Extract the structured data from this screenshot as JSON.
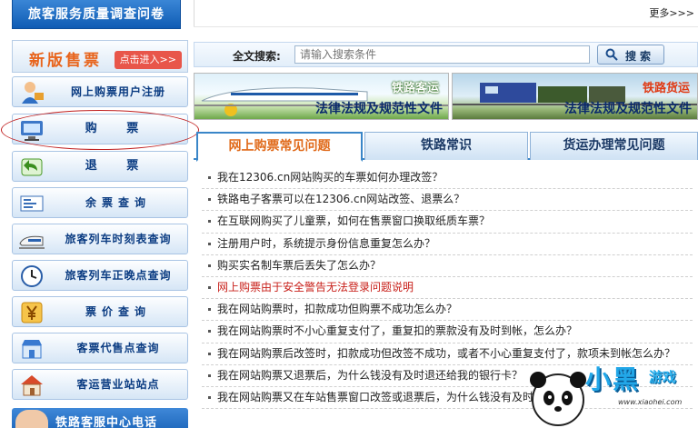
{
  "top": {
    "survey_banner": "旅客服务质量调查问卷",
    "more_link": "更多>>>"
  },
  "sidebar": {
    "new_ticket_title": "新版售票",
    "enter_button": "点击进入>>",
    "items": [
      {
        "label": "网上购票用户注册",
        "icon": "user-icon"
      },
      {
        "label": "购 票",
        "icon": "computer-icon"
      },
      {
        "label": "退 票",
        "icon": "return-arrow-icon"
      },
      {
        "label": "余票查询",
        "icon": "ticket-search-icon"
      },
      {
        "label": "旅客列车时刻表查询",
        "icon": "train-icon"
      },
      {
        "label": "旅客列车正晚点查询",
        "icon": "clock-icon"
      },
      {
        "label": "票价查询",
        "icon": "yen-icon"
      },
      {
        "label": "客票代售点查询",
        "icon": "shop-icon"
      },
      {
        "label": "客运营业站站点",
        "icon": "house-icon"
      }
    ],
    "hotline": "铁路客服中心电话"
  },
  "search": {
    "label": "全文搜索:",
    "placeholder": "请输入搜索条件",
    "button_label": "搜索"
  },
  "banners": {
    "passenger": {
      "tag": "铁路客运",
      "caption": "法律法规及规范性文件"
    },
    "freight": {
      "tag": "铁路货运",
      "caption": "法律法规及规范性文件"
    }
  },
  "tabs": [
    {
      "label": "网上购票常见问题",
      "active": true
    },
    {
      "label": "铁路常识",
      "active": false
    },
    {
      "label": "货运办理常见问题",
      "active": false
    }
  ],
  "faq": [
    {
      "text": "我在12306.cn网站购买的车票如何办理改签？",
      "alert": false
    },
    {
      "text": "铁路电子客票可以在12306.cn网站改签、退票么？",
      "alert": false
    },
    {
      "text": "在互联网购买了儿童票，如何在售票窗口换取纸质车票？",
      "alert": false
    },
    {
      "text": "注册用户时，系统提示身份信息重复怎么办？",
      "alert": false
    },
    {
      "text": "购买实名制车票后丢失了怎么办？",
      "alert": false
    },
    {
      "text": "网上购票由于安全警告无法登录问题说明",
      "alert": true
    },
    {
      "text": "我在网站购票时，扣款成功但购票不成功怎么办？",
      "alert": false
    },
    {
      "text": "我在网站购票时不小心重复支付了，重复扣的票款没有及时到帐，怎么办？",
      "alert": false
    },
    {
      "text": "我在网站购票后改签时，扣款成功但改签不成功，或者不小心重复支付了，款项未到帐怎么办？",
      "alert": false
    },
    {
      "text": "我在网站购票又退票后，为什么钱没有及时退还给我的银行卡？",
      "alert": false
    },
    {
      "text": "我在网站购票又在车站售票窗口改签或退票后，为什么钱没有及时退还",
      "alert": false
    }
  ],
  "watermark": {
    "brand": "小黑",
    "brand2": "游戏",
    "domain": "www.xiaohei.com"
  },
  "colors": {
    "accent_blue": "#3a86c8",
    "active_tab_text": "#e06a1a",
    "alert_text": "#c8201a",
    "highlight_oval": "#c02020"
  }
}
